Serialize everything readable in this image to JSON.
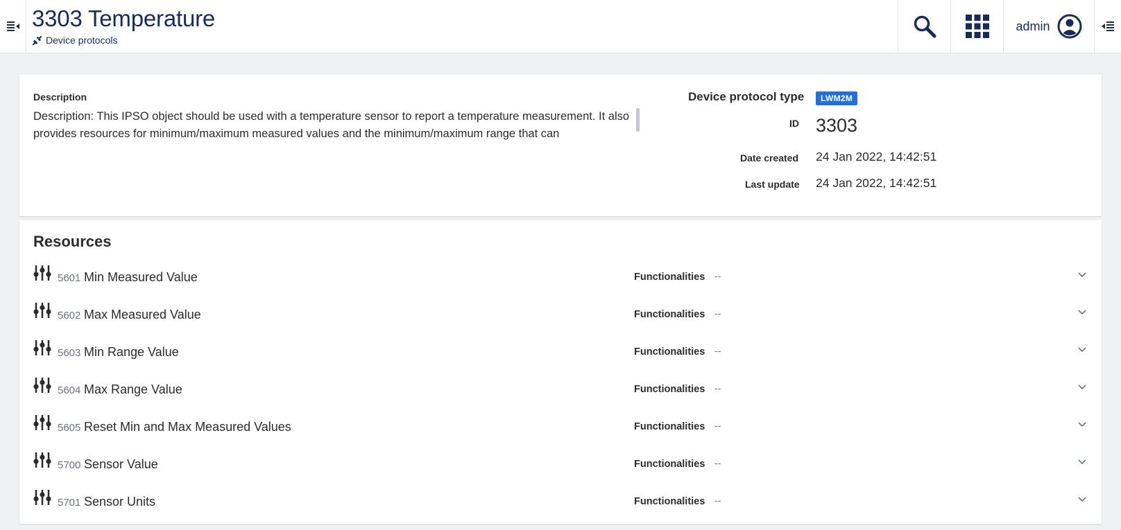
{
  "header": {
    "title": "3303 Temperature",
    "breadcrumb": "Device protocols",
    "user": "admin"
  },
  "info": {
    "description_label": "Description",
    "description_text": "Description: This IPSO object should be used with a temperature sensor to report a temperature measurement. It also provides resources for minimum/maximum measured values and the minimum/maximum range that can",
    "protocol_type_label": "Device protocol type",
    "protocol_type_value": "LWM2M",
    "id_label": "ID",
    "id_value": "3303",
    "date_created_label": "Date created",
    "date_created_value": "24 Jan 2022, 14:42:51",
    "last_update_label": "Last update",
    "last_update_value": "24 Jan 2022, 14:42:51"
  },
  "resources": {
    "title": "Resources",
    "func_label": "Functionalities",
    "items": [
      {
        "id": "5601",
        "name": "Min Measured Value",
        "func": "--"
      },
      {
        "id": "5602",
        "name": "Max Measured Value",
        "func": "--"
      },
      {
        "id": "5603",
        "name": "Min Range Value",
        "func": "--"
      },
      {
        "id": "5604",
        "name": "Max Range Value",
        "func": "--"
      },
      {
        "id": "5605",
        "name": "Reset Min and Max Measured Values",
        "func": "--"
      },
      {
        "id": "5700",
        "name": "Sensor Value",
        "func": "--"
      },
      {
        "id": "5701",
        "name": "Sensor Units",
        "func": "--"
      }
    ]
  },
  "colors": {
    "brand": "#162a5c",
    "badge": "#1f6fe0",
    "background": "#f0f1f2"
  },
  "icons": {
    "left_toggle": "menu-collapse-icon",
    "breadcrumb": "plug-icon",
    "search": "search-icon",
    "apps": "apps-grid-icon",
    "user": "user-circle-icon",
    "right_toggle": "menu-expand-icon",
    "resource": "sliders-icon",
    "chevron": "chevron-down-icon"
  }
}
